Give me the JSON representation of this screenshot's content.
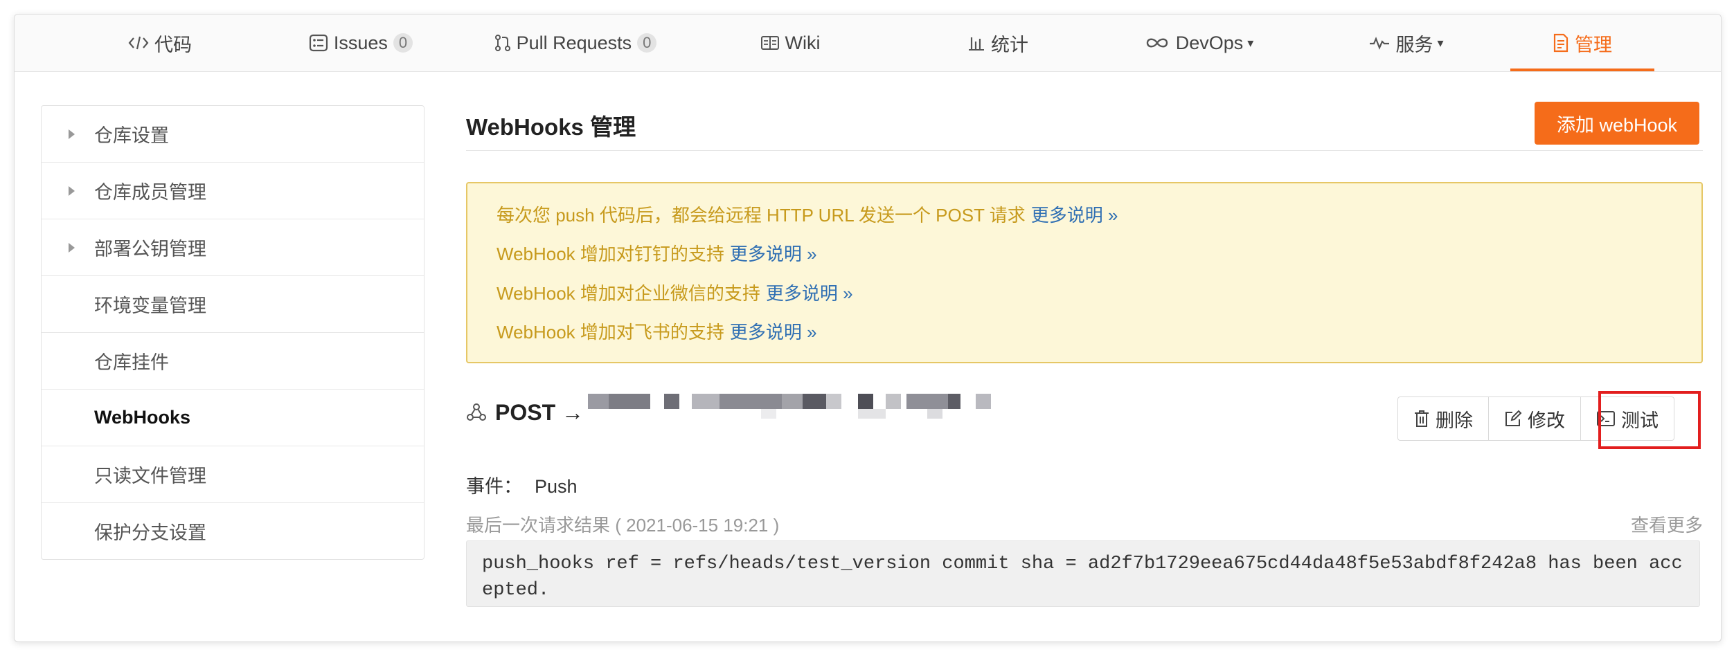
{
  "nav": {
    "tabs": [
      {
        "label": "代码",
        "icon": "code-icon"
      },
      {
        "label": "Issues",
        "count": "0",
        "icon": "issues-icon"
      },
      {
        "label": "Pull Requests",
        "count": "0",
        "icon": "pull-request-icon"
      },
      {
        "label": "Wiki",
        "icon": "wiki-icon"
      },
      {
        "label": "统计",
        "icon": "stats-icon"
      },
      {
        "label": "DevOps",
        "icon": "infinity-icon",
        "dropdown": true
      },
      {
        "label": "服务",
        "icon": "pulse-icon",
        "dropdown": true
      },
      {
        "label": "管理",
        "icon": "manage-icon",
        "active": true
      }
    ],
    "accent": "#f56c1a"
  },
  "sidebar": {
    "items": [
      {
        "label": "仓库设置",
        "expandable": true
      },
      {
        "label": "仓库成员管理",
        "expandable": true
      },
      {
        "label": "部署公钥管理",
        "expandable": true
      },
      {
        "label": "环境变量管理"
      },
      {
        "label": "仓库挂件"
      },
      {
        "label": "WebHooks",
        "active": true
      },
      {
        "label": "只读文件管理"
      },
      {
        "label": "保护分支设置"
      }
    ]
  },
  "main": {
    "title": "WebHooks 管理",
    "add_button": "添加 webHook",
    "notice": [
      {
        "text": "每次您 push 代码后，都会给远程 HTTP URL 发送一个 POST 请求",
        "link": "更多说明 »"
      },
      {
        "text": "WebHook 增加对钉钉的支持",
        "link": "更多说明 »"
      },
      {
        "text": "WebHook 增加对企业微信的支持",
        "link": "更多说明 »"
      },
      {
        "text": "WebHook 增加对飞书的支持",
        "link": "更多说明 »"
      }
    ],
    "hook": {
      "method": "POST →",
      "actions": {
        "delete": "删除",
        "edit": "修改",
        "test": "测试"
      },
      "event_label": "事件：",
      "event_value": "Push",
      "last_result": "最后一次请求结果 ( 2021-06-15 19:21 )",
      "see_more": "查看更多",
      "response": "push_hooks ref = refs/heads/test_version commit sha = ad2f7b1729eea675cd44da48f5e53abdf8f242a8 has been accepted."
    }
  },
  "colors": {
    "accent": "#f56c1a",
    "notice_bg": "#fdf7d8",
    "notice_text": "#c79a1c",
    "link": "#2f6fb3",
    "highlight": "#e21e1e"
  }
}
